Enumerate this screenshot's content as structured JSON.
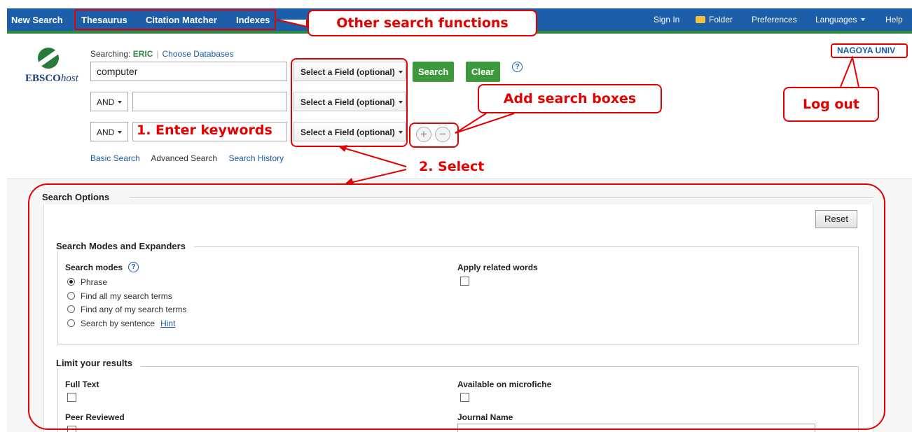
{
  "topnav": {
    "new_search": "New Search",
    "thesaurus": "Thesaurus",
    "citation_matcher": "Citation Matcher",
    "indexes": "Indexes",
    "sign_in": "Sign In",
    "folder": "Folder",
    "preferences": "Preferences",
    "languages": "Languages",
    "help": "Help"
  },
  "logo": {
    "brand": "EBSCO",
    "suffix": "host"
  },
  "search": {
    "searching_label": "Searching:",
    "database": "ERIC",
    "choose_databases": "Choose Databases",
    "rows": [
      {
        "operator": "",
        "value": "computer",
        "field": "Select a Field (optional)"
      },
      {
        "operator": "AND",
        "value": "",
        "field": "Select a Field (optional)"
      },
      {
        "operator": "AND",
        "value": "",
        "field": "Select a Field (optional)"
      }
    ],
    "search_button": "Search",
    "clear_button": "Clear",
    "help_mark": "?",
    "add_glyph": "+",
    "remove_glyph": "−"
  },
  "links": {
    "basic_search": "Basic Search",
    "advanced_search": "Advanced Search",
    "search_history": "Search History"
  },
  "institution": "NAGOYA UNIV",
  "options": {
    "title": "Search Options",
    "reset": "Reset",
    "modes_section": "Search Modes and Expanders",
    "search_modes_label": "Search modes",
    "modes": [
      "Phrase",
      "Find all my search terms",
      "Find any of my search terms",
      "Search by sentence"
    ],
    "selected_mode": "Phrase",
    "hint": "Hint",
    "apply_related": "Apply related words",
    "limit_section": "Limit your results",
    "full_text": "Full Text",
    "available_microfiche": "Available on microfiche",
    "peer_reviewed": "Peer Reviewed",
    "journal_name": "Journal Name"
  },
  "annotations": {
    "other_functions": "Other search functions",
    "add_boxes": "Add search boxes",
    "log_out": "Log out",
    "enter_keywords": "1. Enter keywords",
    "select": "2. Select"
  },
  "colors": {
    "nav_blue": "#1c5ea7",
    "nav_underline": "#2e8b3e",
    "button_green": "#3c9a3c",
    "link_blue": "#1a5aa6",
    "annotation_red": "#e50000"
  }
}
